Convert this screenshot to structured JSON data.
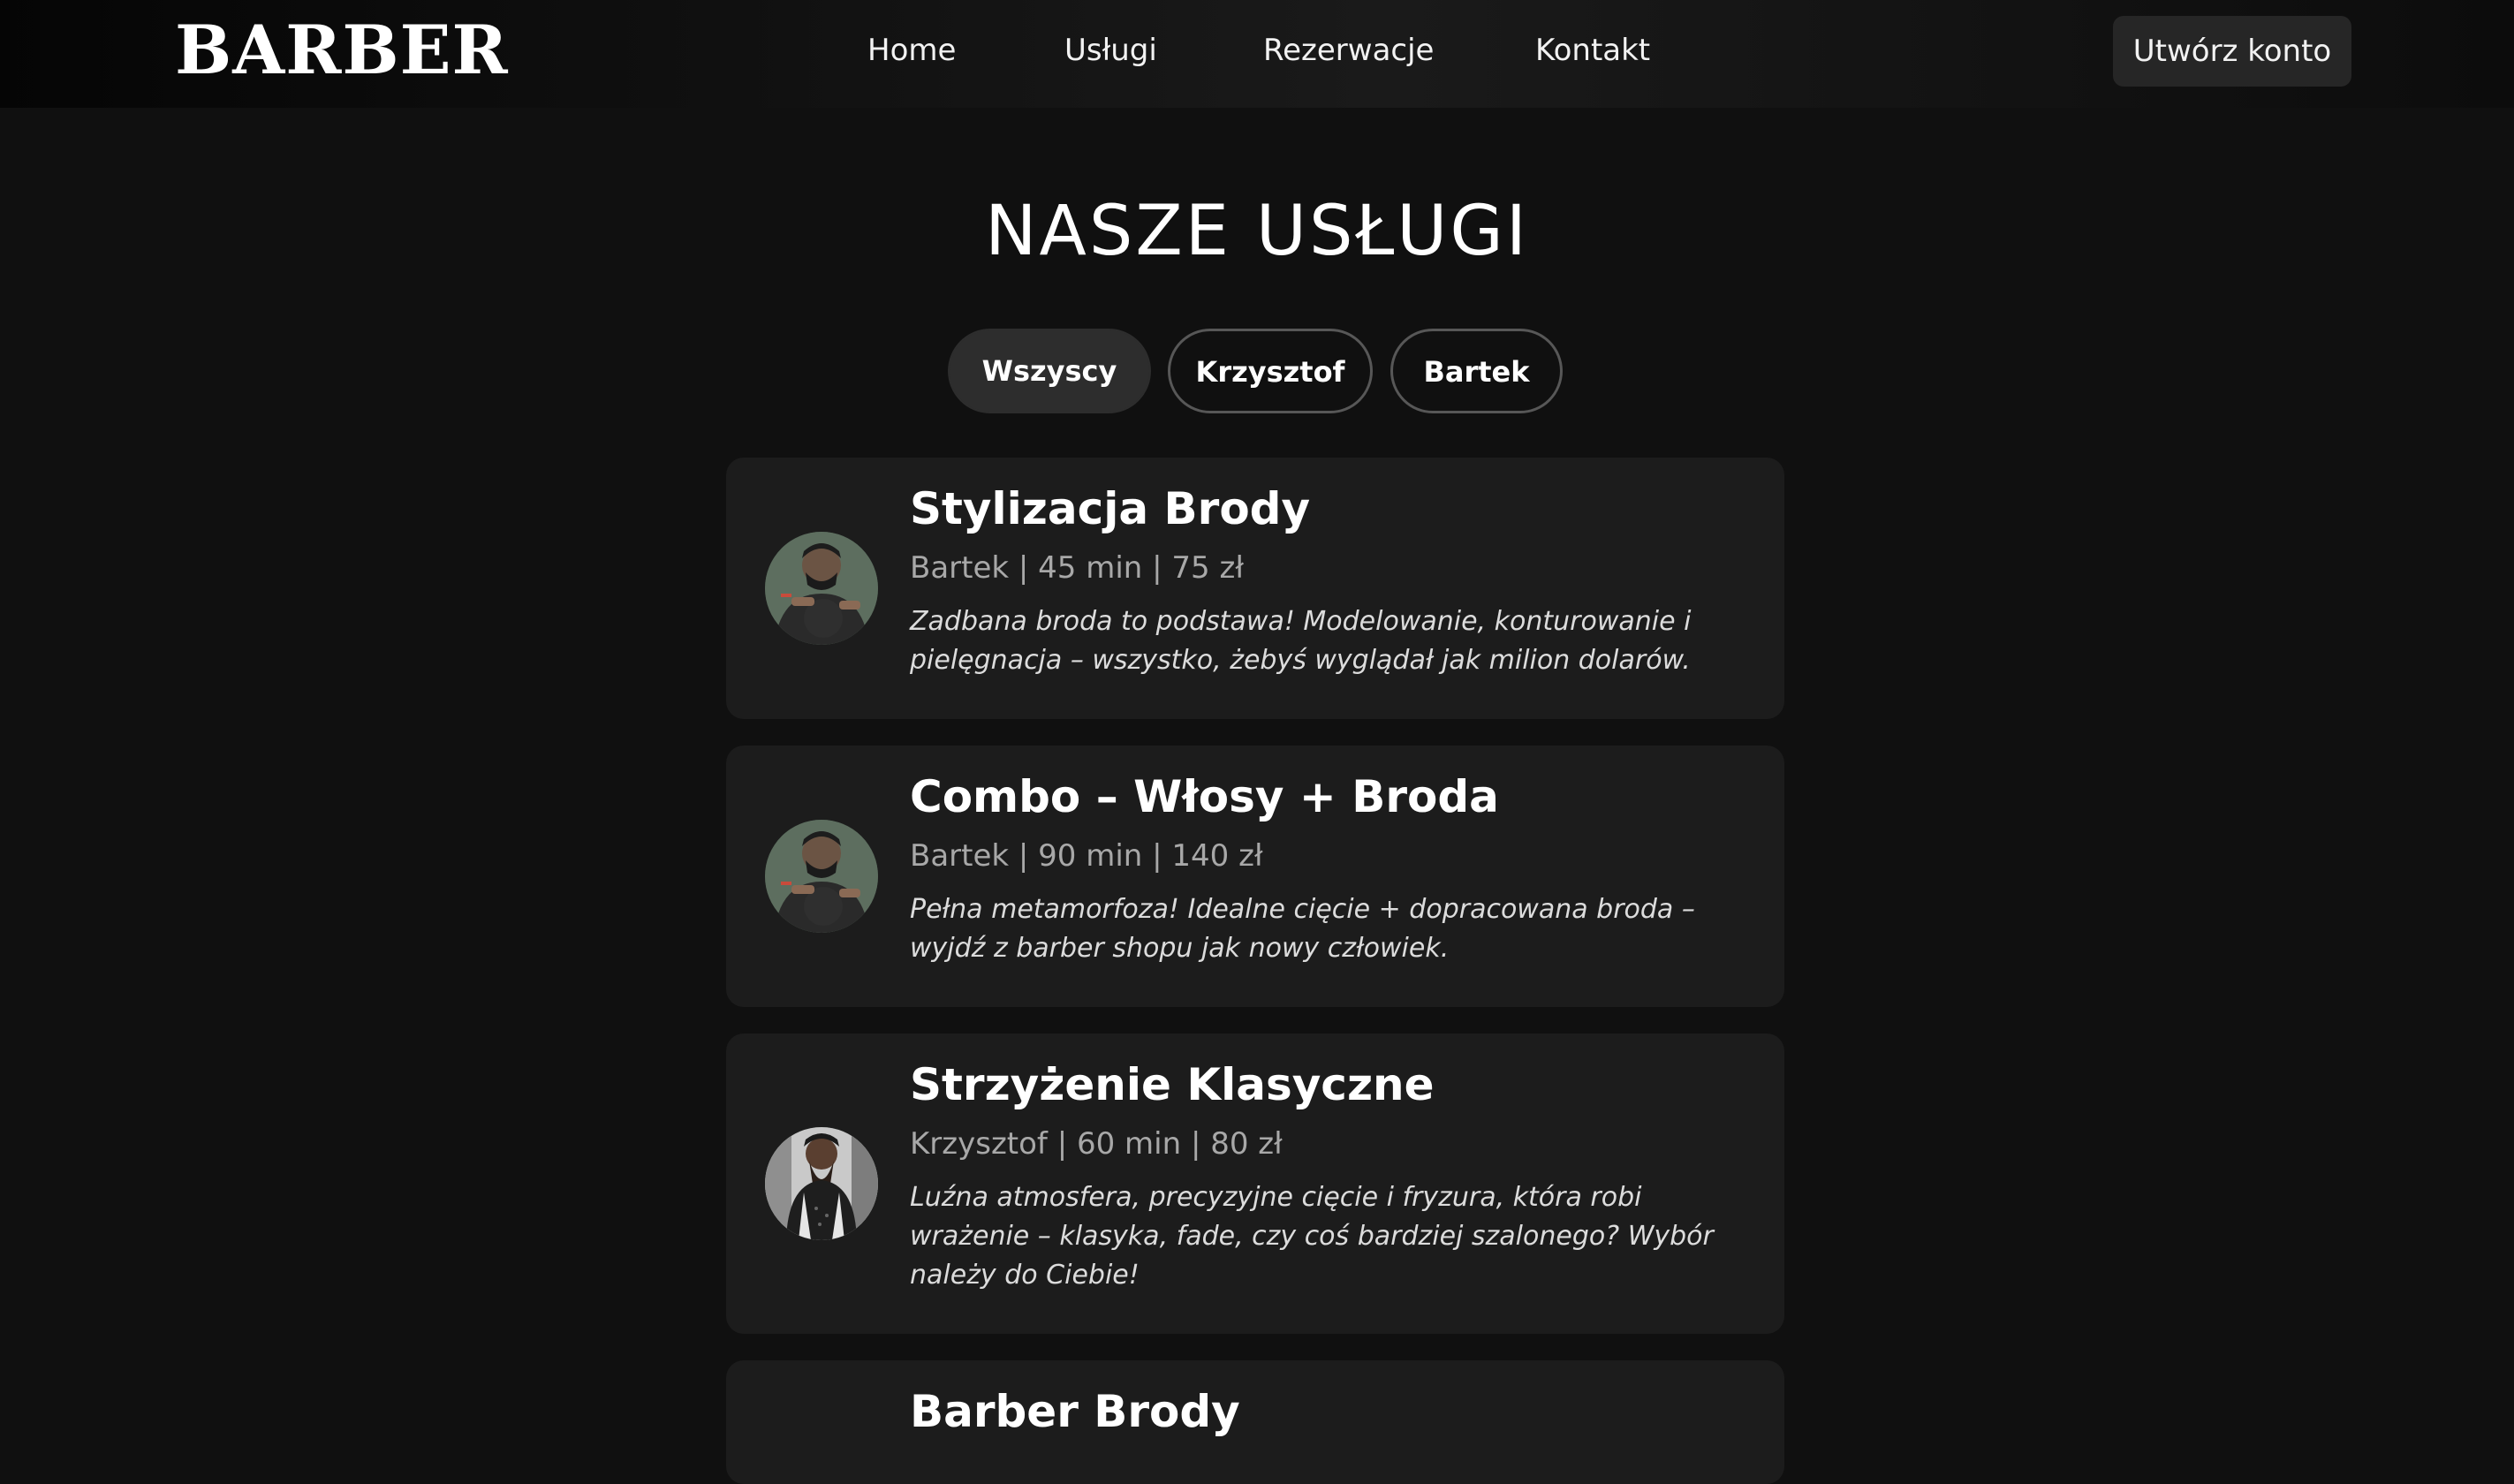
{
  "brand": {
    "logo_text": "BARBER"
  },
  "nav": {
    "links": [
      "Home",
      "Usługi",
      "Rezerwacje",
      "Kontakt"
    ],
    "cta_label": "Utwórz konto"
  },
  "page": {
    "title": "NASZE USŁUGI"
  },
  "filters": {
    "items": [
      "Wszyscy",
      "Krzysztof",
      "Bartek"
    ],
    "active": "Wszyscy"
  },
  "services": [
    {
      "title": "Stylizacja Brody",
      "meta": "Bartek | 45 min | 75 zł",
      "description": "Zadbana broda to podstawa! Modelowanie, konturowanie i pielęgnacja – wszystko, żebyś wyglądał jak milion dolarów.",
      "avatar_icon": "barber-bartek-photo"
    },
    {
      "title": "Combo – Włosy + Broda",
      "meta": "Bartek | 90 min | 140 zł",
      "description": "Pełna metamorfoza! Idealne cięcie + dopracowana broda – wyjdź z barber shopu jak nowy człowiek.",
      "avatar_icon": "barber-bartek-photo"
    },
    {
      "title": "Strzyżenie Klasyczne",
      "meta": "Krzysztof | 60 min | 80 zł",
      "description": "Luźna atmosfera, precyzyjne cięcie i fryzura, która robi wrażenie – klasyka, fade, czy coś bardziej szalonego? Wybór należy do Ciebie!",
      "avatar_icon": "barber-krzysztof-photo"
    },
    {
      "title": "Barber Brody",
      "meta": "",
      "description": "",
      "avatar_icon": ""
    }
  ],
  "colors": {
    "background": "#101010",
    "navbar": "#0a0a0a",
    "card": "#1c1c1c",
    "pill_active": "#2d2d2d",
    "pill_border": "#575757",
    "meta_text": "#a8a8a8"
  }
}
